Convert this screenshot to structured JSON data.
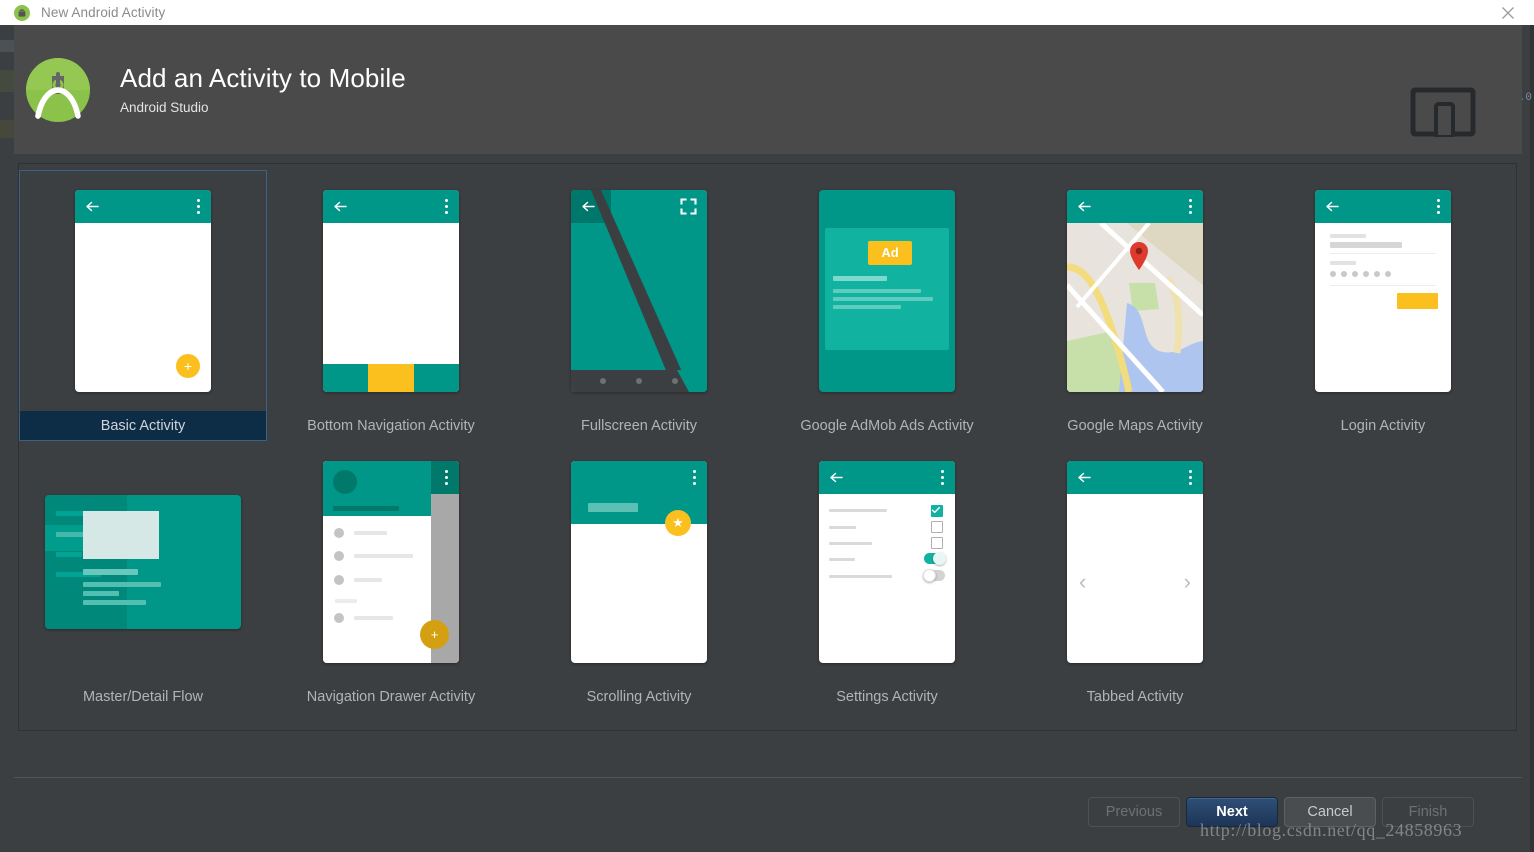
{
  "window": {
    "title": "New Android Activity",
    "app_icon": "android-icon",
    "close_icon": "close-icon"
  },
  "header": {
    "title": "Add an Activity to Mobile",
    "subtitle": "Android Studio",
    "logo_icon": "android-studio-logo-icon",
    "device_icon": "mobile-and-tablet-icon"
  },
  "gallery": {
    "selected": "Basic Activity",
    "templates": [
      {
        "label": "Basic Activity",
        "thumb": "basic-activity-thumb",
        "selected": true
      },
      {
        "label": "Bottom Navigation Activity",
        "thumb": "bottom-navigation-activity-thumb",
        "selected": false
      },
      {
        "label": "Fullscreen Activity",
        "thumb": "fullscreen-activity-thumb",
        "selected": false
      },
      {
        "label": "Google AdMob Ads Activity",
        "thumb": "google-admob-ads-activity-thumb",
        "selected": false
      },
      {
        "label": "Google Maps Activity",
        "thumb": "google-maps-activity-thumb",
        "selected": false
      },
      {
        "label": "Login Activity",
        "thumb": "login-activity-thumb",
        "selected": false
      },
      {
        "label": "Master/Detail Flow",
        "thumb": "master-detail-flow-thumb",
        "selected": false
      },
      {
        "label": "Navigation Drawer Activity",
        "thumb": "navigation-drawer-activity-thumb",
        "selected": false
      },
      {
        "label": "Scrolling Activity",
        "thumb": "scrolling-activity-thumb",
        "selected": false
      },
      {
        "label": "Settings Activity",
        "thumb": "settings-activity-thumb",
        "selected": false
      },
      {
        "label": "Tabbed Activity",
        "thumb": "tabbed-activity-thumb",
        "selected": false
      }
    ],
    "admob_badge": "Ad"
  },
  "footer": {
    "previous_label": "Previous",
    "next_label": "Next",
    "cancel_label": "Cancel",
    "finish_label": "Finish"
  },
  "watermark": "http://blog.csdn.net/qq_24858963",
  "colors": {
    "teal": "#009688",
    "teal_dark": "#00796b",
    "amber": "#fbbf1e",
    "selection_navy": "#0d2c45",
    "selection_border": "#3d6185",
    "header_band": "#4a4a4a",
    "dialog_bg": "#3c3f41",
    "titlebar_bg": "#ffffff",
    "primary_button": "#1d3557",
    "map_land": "#e8e3dc",
    "map_water": "#aec5ef",
    "map_green": "#c7e0a9",
    "map_pin_red": "#dd3b2e"
  }
}
